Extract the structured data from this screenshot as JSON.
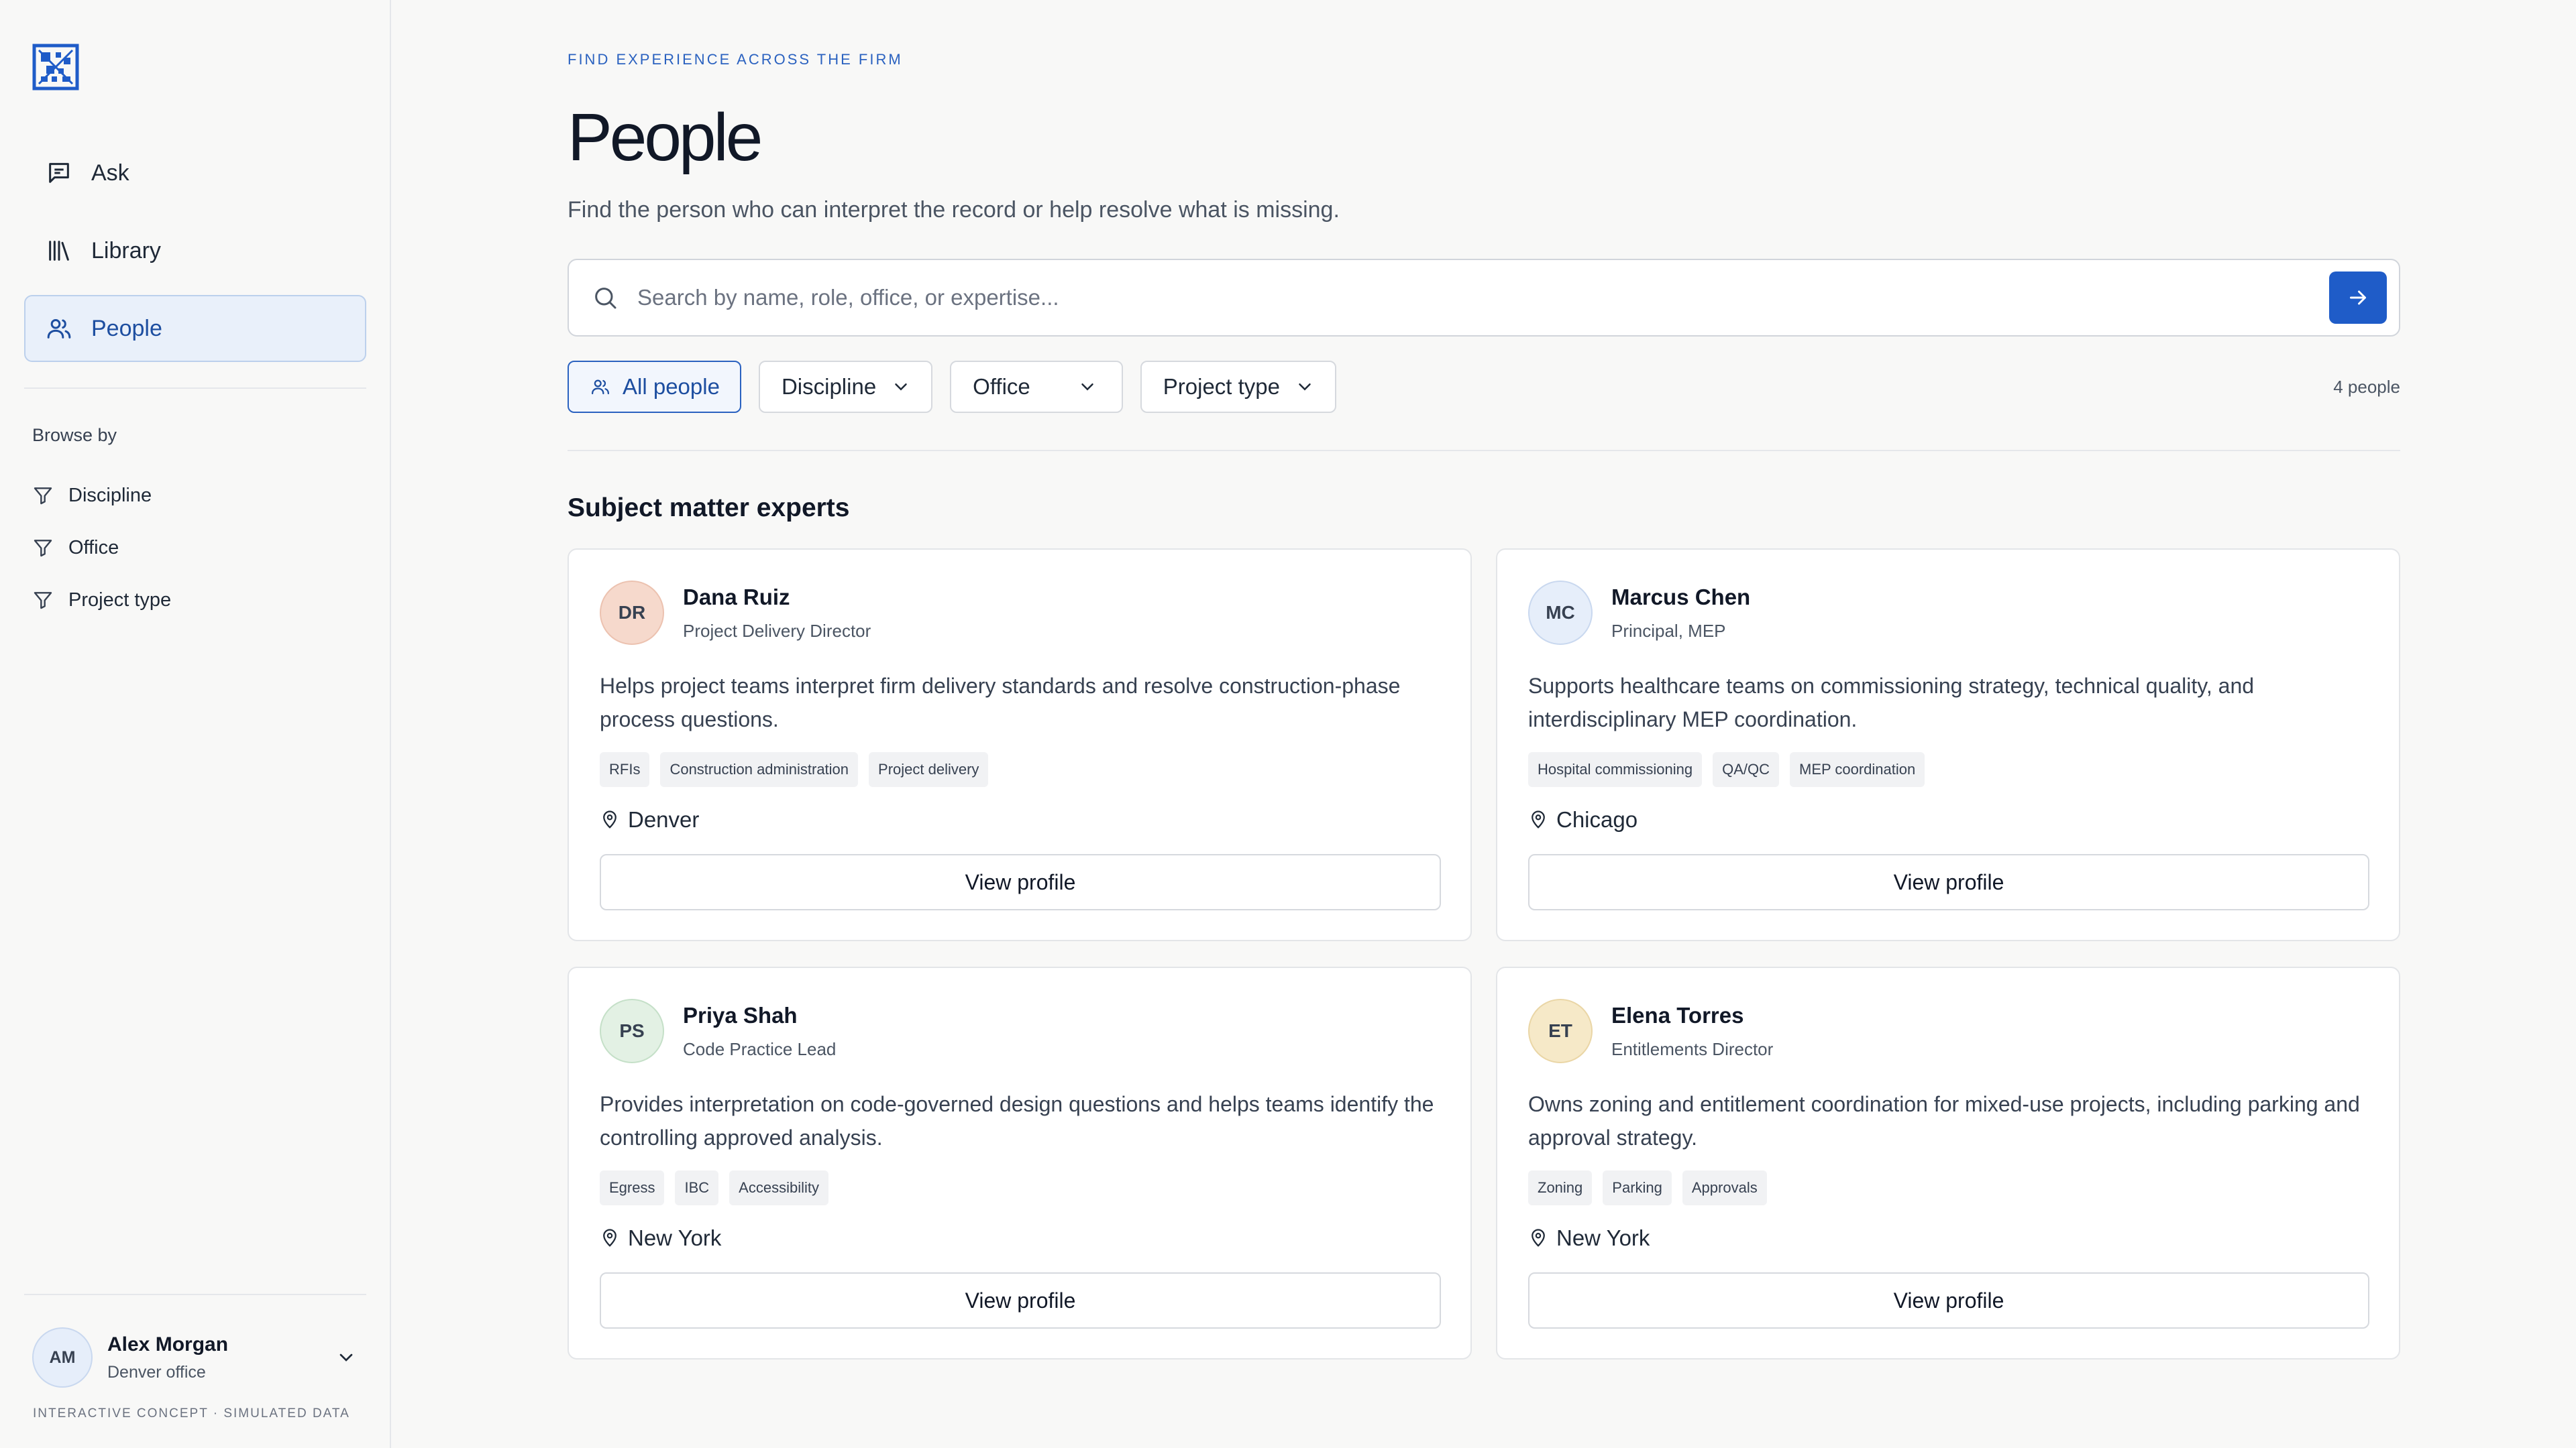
{
  "colors": {
    "accent": "#1f5cc8",
    "active_nav_bg": "#e9f0fa",
    "page_bg": "#f8f8f7"
  },
  "sidebar": {
    "nav": [
      {
        "label": "Ask",
        "icon": "message-icon"
      },
      {
        "label": "Library",
        "icon": "library-icon"
      },
      {
        "label": "People",
        "icon": "people-icon",
        "active": true
      }
    ],
    "browse_label": "Browse by",
    "browse": [
      {
        "label": "Discipline",
        "icon": "filter-icon"
      },
      {
        "label": "Office",
        "icon": "filter-icon"
      },
      {
        "label": "Project type",
        "icon": "filter-icon"
      }
    ],
    "user": {
      "initials": "AM",
      "name": "Alex Morgan",
      "office": "Denver office"
    },
    "footnote": "INTERACTIVE CONCEPT · SIMULATED DATA"
  },
  "header": {
    "eyebrow": "FIND EXPERIENCE ACROSS THE FIRM",
    "title": "People",
    "subtitle": "Find the person who can interpret the record or help resolve what is missing."
  },
  "search": {
    "placeholder": "Search by name, role, office, or expertise...",
    "value": ""
  },
  "filters": {
    "all": "All people",
    "discipline": "Discipline",
    "office": "Office",
    "project_type": "Project type",
    "count": "4 people"
  },
  "section_title": "Subject matter experts",
  "people": [
    {
      "initials": "DR",
      "avatar_color": "#f6d9cc",
      "avatar_border": "#ecc2b0",
      "name": "Dana Ruiz",
      "role": "Project Delivery Director",
      "description": "Helps project teams interpret firm delivery standards and resolve construction-phase process questions.",
      "tags": [
        "RFIs",
        "Construction administration",
        "Project delivery"
      ],
      "location": "Denver",
      "button": "View profile"
    },
    {
      "initials": "MC",
      "avatar_color": "#e6eefa",
      "avatar_border": "#c9d8ef",
      "name": "Marcus Chen",
      "role": "Principal, MEP",
      "description": "Supports healthcare teams on commissioning strategy, technical quality, and interdisciplinary MEP coordination.",
      "tags": [
        "Hospital commissioning",
        "QA/QC",
        "MEP coordination"
      ],
      "location": "Chicago",
      "button": "View profile"
    },
    {
      "initials": "PS",
      "avatar_color": "#e3f1e4",
      "avatar_border": "#c5e0c8",
      "name": "Priya Shah",
      "role": "Code Practice Lead",
      "description": "Provides interpretation on code-governed design questions and helps teams identify the controlling approved analysis.",
      "tags": [
        "Egress",
        "IBC",
        "Accessibility"
      ],
      "location": "New York",
      "button": "View profile"
    },
    {
      "initials": "ET",
      "avatar_color": "#f6e9c8",
      "avatar_border": "#ead6a6",
      "name": "Elena Torres",
      "role": "Entitlements Director",
      "description": "Owns zoning and entitlement coordination for mixed-use projects, including parking and approval strategy.",
      "tags": [
        "Zoning",
        "Parking",
        "Approvals"
      ],
      "location": "New York",
      "button": "View profile"
    }
  ]
}
